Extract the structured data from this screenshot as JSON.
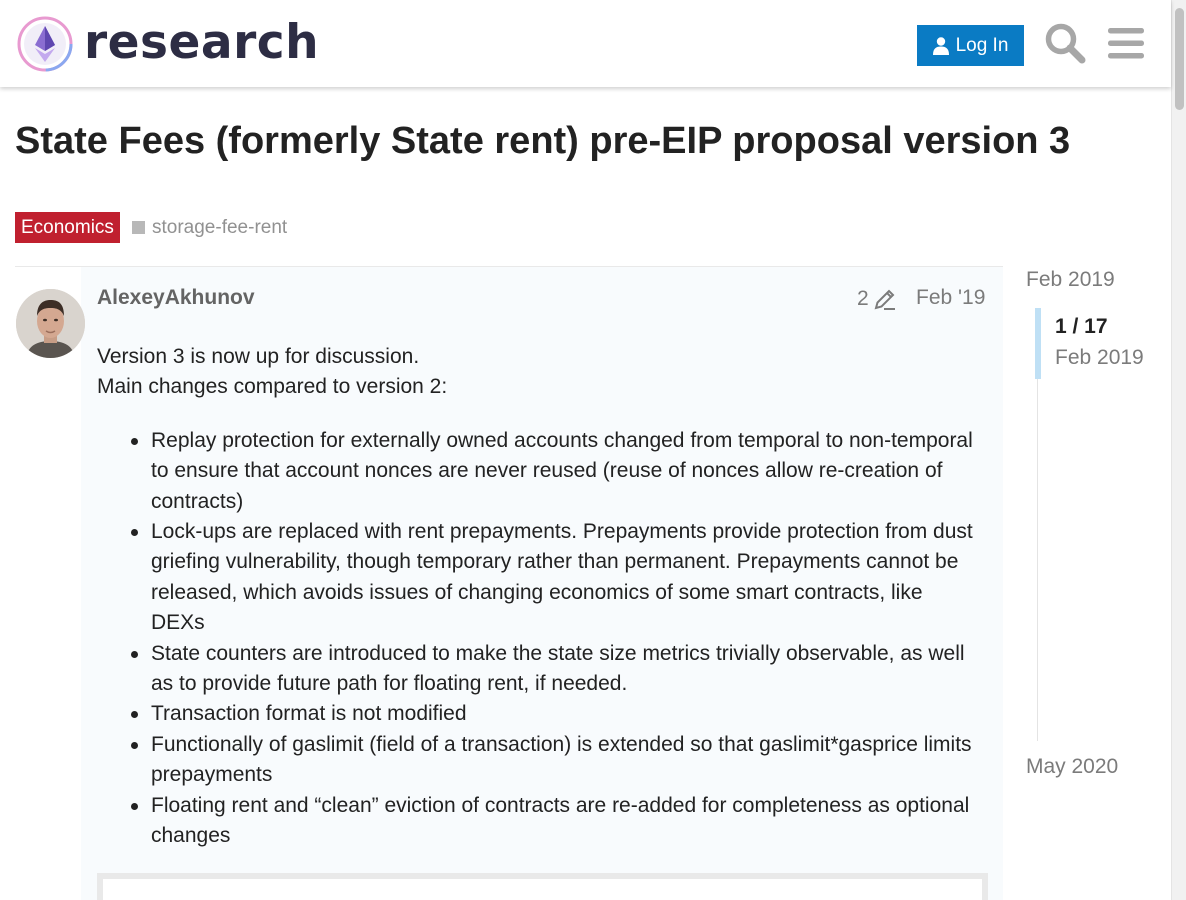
{
  "header": {
    "site_name": "research",
    "login_label": "Log In",
    "search_icon": "search-icon",
    "menu_icon": "hamburger-menu-icon",
    "brand_color": "#0a7bc4"
  },
  "topic": {
    "title": "State Fees (formerly State rent) pre-EIP proposal version 3",
    "category": "Economics",
    "category_color": "#c0202f",
    "tag": "storage-fee-rent"
  },
  "post": {
    "author": "AlexeyAkhunov",
    "edit_count": "2",
    "date": "Feb '19",
    "intro_line_1": "Version 3 is now up for discussion.",
    "intro_line_2": "Main changes compared to version 2:",
    "changes": [
      "Replay protection for externally owned accounts changed from temporal to non-temporal to ensure that account nonces are never reused (reuse of nonces allow re-creation of contracts)",
      "Lock-ups are replaced with rent prepayments. Prepayments provide protection from dust griefing vulnerability, though temporary rather than permanent. Prepayments cannot be released, which avoids issues of changing economics of some smart contracts, like DEXs",
      "State counters are introduced to make the state size metrics trivially observable, as well as to provide future path for floating rent, if needed.",
      "Transaction format is not modified",
      "Functionally of gaslimit (field of a transaction) is extended so that gaslimit*gasprice limits prepayments",
      "Floating rent and “clean” eviction of contracts are re-added for completeness as optional changes"
    ]
  },
  "timeline": {
    "start_date": "Feb 2019",
    "position": "1 / 17",
    "current_date": "Feb 2019",
    "end_date": "May 2020"
  }
}
